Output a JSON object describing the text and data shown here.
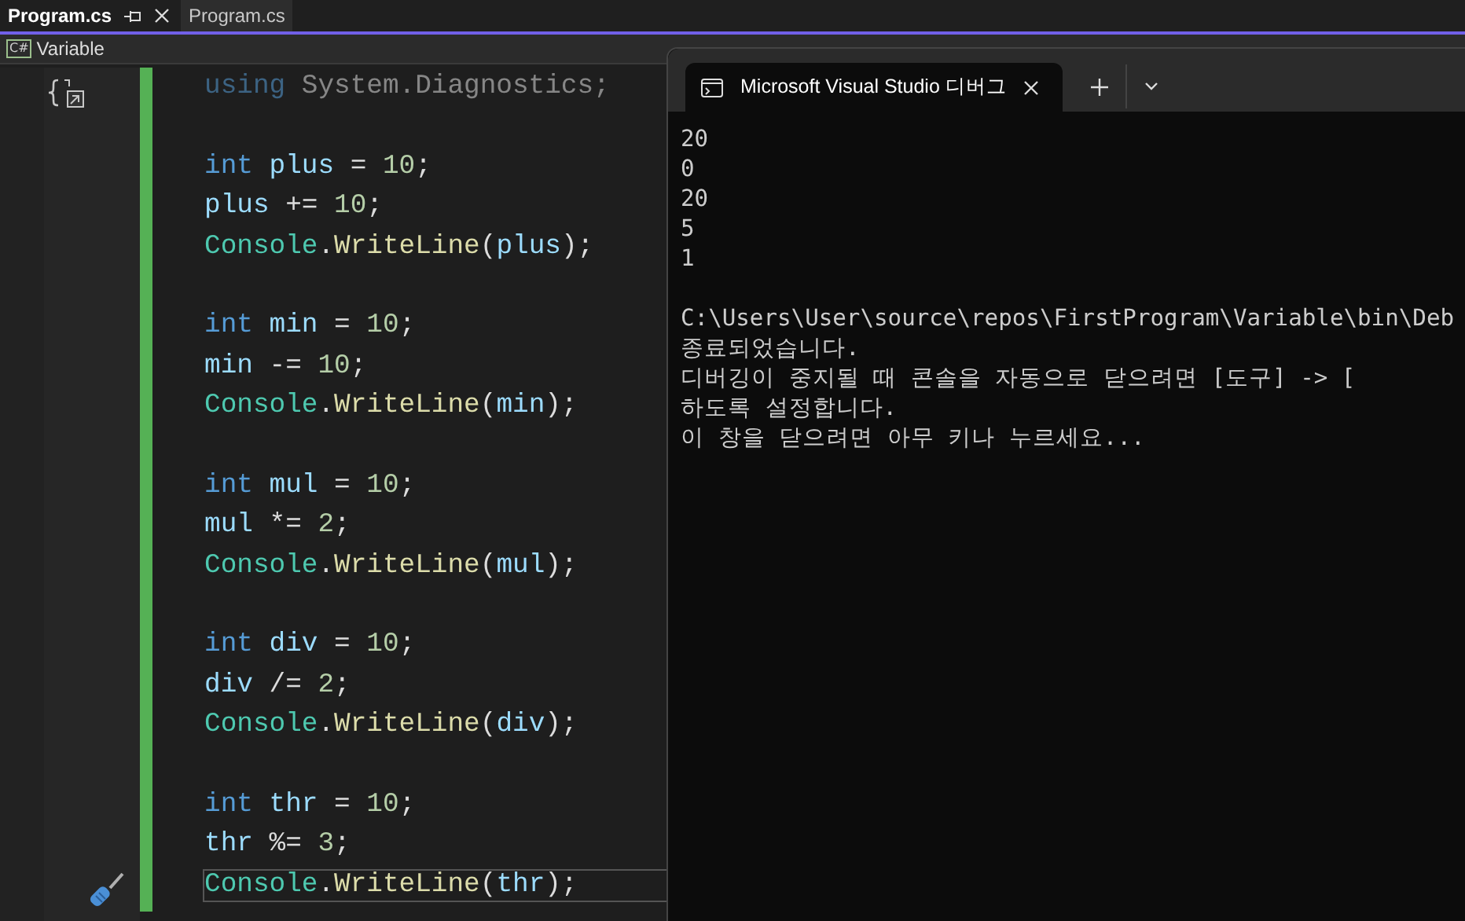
{
  "document_tabs": [
    {
      "label": "Program.cs",
      "selected": true
    },
    {
      "label": "Program.cs",
      "selected": false
    }
  ],
  "navigation_bar": {
    "file_type": "C#",
    "project": "Variable"
  },
  "code": {
    "lines": [
      {
        "kind": "code",
        "faded": true,
        "current": false,
        "tokens": [
          {
            "text": "using",
            "kind": "keyword"
          },
          {
            "text": " System.Diagnostics;",
            "kind": "plain"
          }
        ]
      },
      {
        "kind": "blank"
      },
      {
        "kind": "code",
        "faded": false,
        "current": false,
        "tokens": [
          {
            "text": "int",
            "kind": "keyword"
          },
          {
            "text": " plus",
            "kind": "ident"
          },
          {
            "text": " = ",
            "kind": "plain"
          },
          {
            "text": "10",
            "kind": "number"
          },
          {
            "text": ";",
            "kind": "plain"
          }
        ]
      },
      {
        "kind": "code",
        "faded": false,
        "current": false,
        "tokens": [
          {
            "text": "plus",
            "kind": "ident"
          },
          {
            "text": " += ",
            "kind": "plain"
          },
          {
            "text": "10",
            "kind": "number"
          },
          {
            "text": ";",
            "kind": "plain"
          }
        ]
      },
      {
        "kind": "code",
        "faded": false,
        "current": false,
        "tokens": [
          {
            "text": "Console",
            "kind": "type"
          },
          {
            "text": ".",
            "kind": "plain"
          },
          {
            "text": "WriteLine",
            "kind": "method"
          },
          {
            "text": "(",
            "kind": "plain"
          },
          {
            "text": "plus",
            "kind": "ident"
          },
          {
            "text": ");",
            "kind": "plain"
          }
        ]
      },
      {
        "kind": "blank"
      },
      {
        "kind": "code",
        "faded": false,
        "current": false,
        "tokens": [
          {
            "text": "int",
            "kind": "keyword"
          },
          {
            "text": " min",
            "kind": "ident"
          },
          {
            "text": " = ",
            "kind": "plain"
          },
          {
            "text": "10",
            "kind": "number"
          },
          {
            "text": ";",
            "kind": "plain"
          }
        ]
      },
      {
        "kind": "code",
        "faded": false,
        "current": false,
        "tokens": [
          {
            "text": "min",
            "kind": "ident"
          },
          {
            "text": " -= ",
            "kind": "plain"
          },
          {
            "text": "10",
            "kind": "number"
          },
          {
            "text": ";",
            "kind": "plain"
          }
        ]
      },
      {
        "kind": "code",
        "faded": false,
        "current": false,
        "tokens": [
          {
            "text": "Console",
            "kind": "type"
          },
          {
            "text": ".",
            "kind": "plain"
          },
          {
            "text": "WriteLine",
            "kind": "method"
          },
          {
            "text": "(",
            "kind": "plain"
          },
          {
            "text": "min",
            "kind": "ident"
          },
          {
            "text": ");",
            "kind": "plain"
          }
        ]
      },
      {
        "kind": "blank"
      },
      {
        "kind": "code",
        "faded": false,
        "current": false,
        "tokens": [
          {
            "text": "int",
            "kind": "keyword"
          },
          {
            "text": " mul",
            "kind": "ident"
          },
          {
            "text": " = ",
            "kind": "plain"
          },
          {
            "text": "10",
            "kind": "number"
          },
          {
            "text": ";",
            "kind": "plain"
          }
        ]
      },
      {
        "kind": "code",
        "faded": false,
        "current": false,
        "tokens": [
          {
            "text": "mul",
            "kind": "ident"
          },
          {
            "text": " *= ",
            "kind": "plain"
          },
          {
            "text": "2",
            "kind": "number"
          },
          {
            "text": ";",
            "kind": "plain"
          }
        ]
      },
      {
        "kind": "code",
        "faded": false,
        "current": false,
        "tokens": [
          {
            "text": "Console",
            "kind": "type"
          },
          {
            "text": ".",
            "kind": "plain"
          },
          {
            "text": "WriteLine",
            "kind": "method"
          },
          {
            "text": "(",
            "kind": "plain"
          },
          {
            "text": "mul",
            "kind": "ident"
          },
          {
            "text": ");",
            "kind": "plain"
          }
        ]
      },
      {
        "kind": "blank"
      },
      {
        "kind": "code",
        "faded": false,
        "current": false,
        "tokens": [
          {
            "text": "int",
            "kind": "keyword"
          },
          {
            "text": " div",
            "kind": "ident"
          },
          {
            "text": " = ",
            "kind": "plain"
          },
          {
            "text": "10",
            "kind": "number"
          },
          {
            "text": ";",
            "kind": "plain"
          }
        ]
      },
      {
        "kind": "code",
        "faded": false,
        "current": false,
        "tokens": [
          {
            "text": "div",
            "kind": "ident"
          },
          {
            "text": " /= ",
            "kind": "plain"
          },
          {
            "text": "2",
            "kind": "number"
          },
          {
            "text": ";",
            "kind": "plain"
          }
        ]
      },
      {
        "kind": "code",
        "faded": false,
        "current": false,
        "tokens": [
          {
            "text": "Console",
            "kind": "type"
          },
          {
            "text": ".",
            "kind": "plain"
          },
          {
            "text": "WriteLine",
            "kind": "method"
          },
          {
            "text": "(",
            "kind": "plain"
          },
          {
            "text": "div",
            "kind": "ident"
          },
          {
            "text": ");",
            "kind": "plain"
          }
        ]
      },
      {
        "kind": "blank"
      },
      {
        "kind": "code",
        "faded": false,
        "current": false,
        "tokens": [
          {
            "text": "int",
            "kind": "keyword"
          },
          {
            "text": " thr",
            "kind": "ident"
          },
          {
            "text": " = ",
            "kind": "plain"
          },
          {
            "text": "10",
            "kind": "number"
          },
          {
            "text": ";",
            "kind": "plain"
          }
        ]
      },
      {
        "kind": "code",
        "faded": false,
        "current": false,
        "tokens": [
          {
            "text": "thr",
            "kind": "ident"
          },
          {
            "text": " %= ",
            "kind": "plain"
          },
          {
            "text": "3",
            "kind": "number"
          },
          {
            "text": ";",
            "kind": "plain"
          }
        ]
      },
      {
        "kind": "code",
        "faded": false,
        "current": true,
        "tokens": [
          {
            "text": "Console",
            "kind": "type"
          },
          {
            "text": ".",
            "kind": "plain"
          },
          {
            "text": "WriteLine",
            "kind": "method"
          },
          {
            "text": "(",
            "kind": "plain"
          },
          {
            "text": "thr",
            "kind": "ident"
          },
          {
            "text": ");",
            "kind": "plain"
          }
        ]
      }
    ]
  },
  "console": {
    "tab_title": "Microsoft Visual Studio 디버그",
    "lines": [
      {
        "kind": "text",
        "text": "20"
      },
      {
        "kind": "text",
        "text": "0"
      },
      {
        "kind": "text",
        "text": "20"
      },
      {
        "kind": "text",
        "text": "5"
      },
      {
        "kind": "text",
        "text": "1"
      },
      {
        "kind": "blank"
      },
      {
        "kind": "text",
        "text": "C:\\Users\\User\\source\\repos\\FirstProgram\\Variable\\bin\\Deb"
      },
      {
        "kind": "text",
        "text": "종료되었습니다."
      },
      {
        "kind": "text",
        "text": "디버깅이 중지될 때 콘솔을 자동으로 닫으려면 [도구] -> ["
      },
      {
        "kind": "text",
        "text": "하도록 설정합니다."
      },
      {
        "kind": "text",
        "text": "이 창을 닫으려면 아무 키나 누르세요..."
      }
    ]
  }
}
